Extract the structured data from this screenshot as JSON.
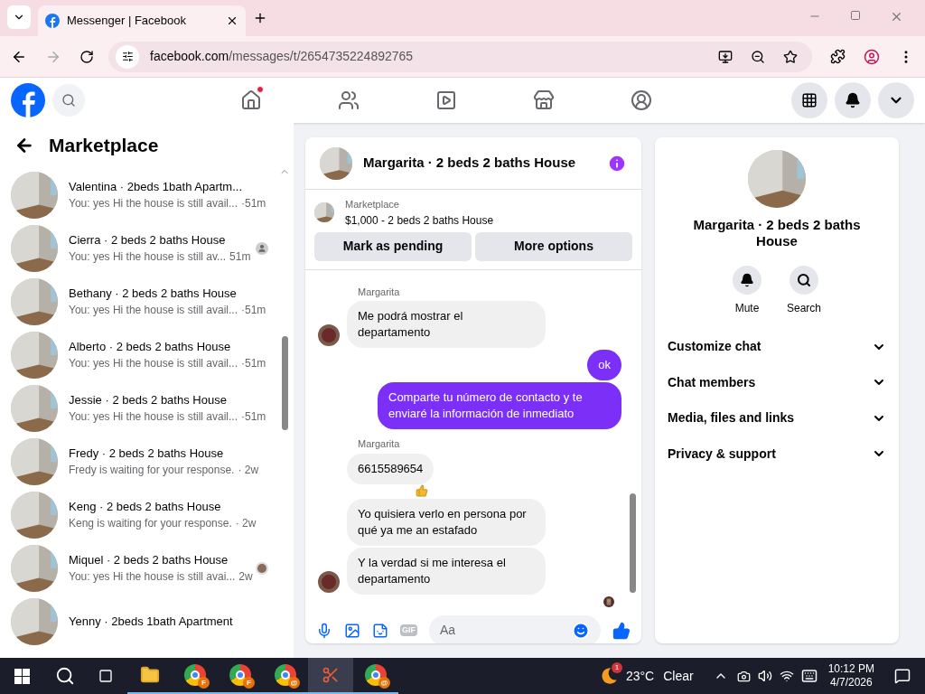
{
  "browser": {
    "tab_title": "Messenger | Facebook",
    "url_host": "facebook.com",
    "url_path": "/messages/t/2654735224892765"
  },
  "nav": [
    {
      "kind": "home",
      "dot": true
    },
    {
      "kind": "friends",
      "dot": false
    },
    {
      "kind": "video",
      "dot": false
    },
    {
      "kind": "market",
      "dot": false
    },
    {
      "kind": "groups",
      "dot": false
    }
  ],
  "sidebar": {
    "title": "Marketplace",
    "items": [
      {
        "name": "Valentina · 2beds 1bath Apartm...",
        "preview": "You: yes Hi the house is still avail...",
        "time": "·51m",
        "seen_icon": false,
        "seen_photo": false
      },
      {
        "name": "Cierra · 2 beds 2 baths House",
        "preview": "You: yes Hi the house is still av...",
        "time": "51m",
        "seen_icon": true,
        "seen_photo": false
      },
      {
        "name": "Bethany · 2 beds 2 baths House",
        "preview": "You: yes Hi the house is still avail...",
        "time": "·51m",
        "seen_icon": false,
        "seen_photo": false
      },
      {
        "name": "Alberto · 2 beds 2 baths House",
        "preview": "You: yes Hi the house is still avail...",
        "time": "·51m",
        "seen_icon": false,
        "seen_photo": false
      },
      {
        "name": "Jessie · 2 beds 2 baths House",
        "preview": "You: yes Hi the house is still avail...",
        "time": "·51m",
        "seen_icon": false,
        "seen_photo": false
      },
      {
        "name": "Fredy · 2 beds 2 baths House",
        "preview": "Fredy is waiting for your response.",
        "time": "· 2w",
        "seen_icon": false,
        "seen_photo": false
      },
      {
        "name": "Keng · 2 beds 2 baths House",
        "preview": "Keng is waiting for your response.",
        "time": "· 2w",
        "seen_icon": false,
        "seen_photo": false
      },
      {
        "name": "Miquel · 2 beds 2 baths House",
        "preview": "You: yes Hi the house is still avai...",
        "time": "2w",
        "seen_icon": false,
        "seen_photo": true
      },
      {
        "name": "Yenny · 2beds 1bath Apartment",
        "seen_icon": false,
        "seen_photo": false
      }
    ]
  },
  "chat": {
    "title": "Margarita · 2 beds 2 baths House",
    "listing": {
      "label": "Marketplace",
      "price": "$1,000 - 2 beds 2 baths House"
    },
    "actions": [
      "Mark as pending",
      "More options"
    ],
    "messages": [
      {
        "kind": "incoming",
        "sender": "Margarita",
        "text": "Me podrá mostrar el departamento",
        "avatar": true,
        "reaction": false
      },
      {
        "kind": "outgoing",
        "text": "ok"
      },
      {
        "kind": "outgoing",
        "text": "Comparte tu número de contacto y te enviaré la información de inmediato"
      },
      {
        "kind": "incoming",
        "sender": "Margarita",
        "text": "6615589654",
        "avatar": false,
        "reaction": true
      },
      {
        "kind": "incoming",
        "text": "Yo quisiera verlo en persona por qué ya me an estafado",
        "avatar": false,
        "reaction": false
      },
      {
        "kind": "incoming",
        "text": "Y la verdad si me interesa el departamento",
        "avatar": true,
        "reaction": false
      }
    ],
    "composer": {
      "gif": "GIF",
      "placeholder": "Aa"
    }
  },
  "details": {
    "title": "Margarita · 2 beds 2 baths House",
    "buttons": [
      {
        "kind": "mute",
        "label": "Mute"
      },
      {
        "kind": "search",
        "label": "Search"
      }
    ],
    "sections": [
      {
        "label": "Customize chat",
        "expanded": false
      },
      {
        "label": "Chat members",
        "expanded": false
      },
      {
        "label": "Media, files and links",
        "expanded": false
      },
      {
        "label": "Privacy & support",
        "expanded": false
      }
    ]
  },
  "taskbar": {
    "apps": [
      {
        "kind": "explorer",
        "selected": false
      },
      {
        "kind": "chrome",
        "selected": false,
        "badge": "F"
      },
      {
        "kind": "chrome",
        "selected": false,
        "badge": "F"
      },
      {
        "kind": "chrome",
        "selected": false,
        "badge": "@"
      },
      {
        "kind": "snip",
        "selected": true
      },
      {
        "kind": "chrome",
        "selected": false,
        "badge": "@"
      }
    ],
    "weather_badge": "1",
    "temperature": "23°C",
    "condition": "Clear",
    "time": "10:12 PM",
    "date": "4/7/2026"
  }
}
